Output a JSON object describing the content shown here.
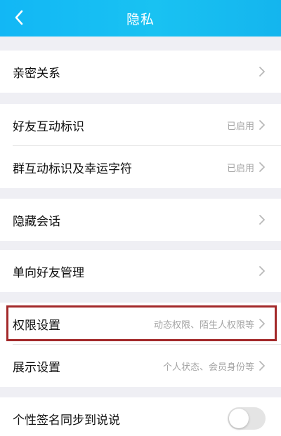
{
  "navbar": {
    "title": "隐私",
    "back_icon": "chevron-left-icon"
  },
  "sections": {
    "intimate": {
      "label": "亲密关系"
    },
    "friend_interaction": {
      "label": "好友互动标识",
      "value": "已启用"
    },
    "group_interaction": {
      "label": "群互动标识及幸运字符",
      "value": "已启用"
    },
    "hidden_chats": {
      "label": "隐藏会话"
    },
    "one_way_friends": {
      "label": "单向好友管理"
    },
    "permissions": {
      "label": "权限设置",
      "value": "动态权限、陌生人权限等"
    },
    "display": {
      "label": "展示设置",
      "value": "个人状态、会员身份等"
    },
    "signature_sync": {
      "label": "个性签名同步到说说",
      "toggle_on": false
    }
  },
  "colors": {
    "navbar": "#14b9f2",
    "highlight_border": "#a3292a",
    "background": "#efeff4"
  }
}
